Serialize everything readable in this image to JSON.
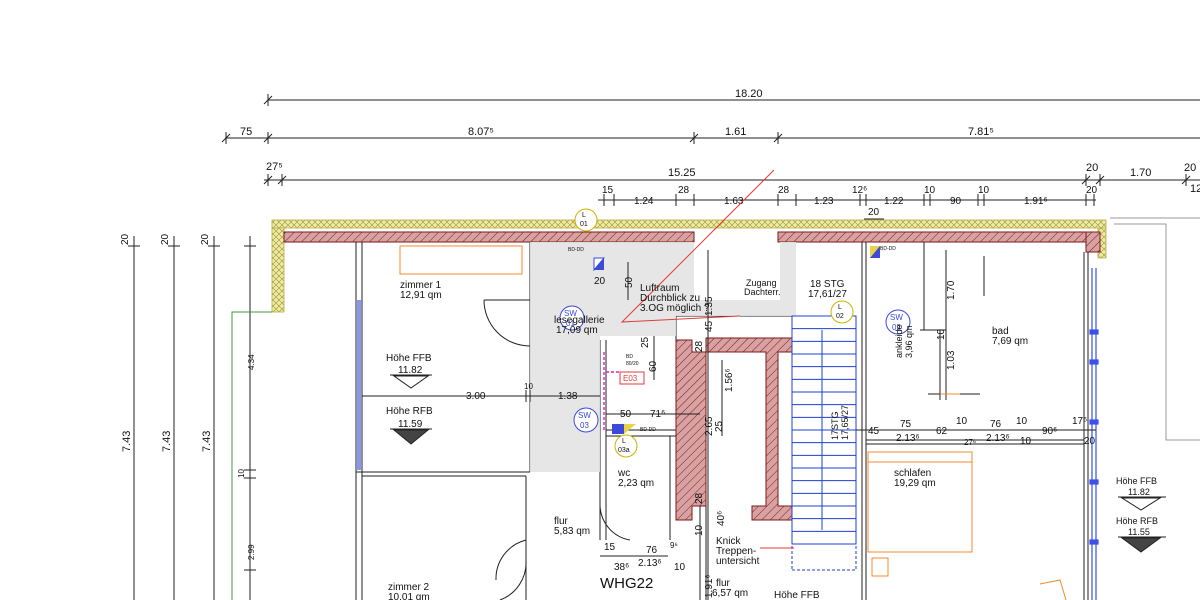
{
  "dimensions": {
    "overall": "18.20",
    "row2": [
      "75",
      "8.07⁵",
      "1.61",
      "7.81⁵"
    ],
    "row3": [
      "27⁵",
      "15.25",
      "20",
      "1.70",
      "20",
      "12"
    ],
    "row4": [
      "15",
      "1.24",
      "28",
      "1.63",
      "28",
      "1.23",
      "12⁶",
      "1.22",
      "10",
      "90",
      "10",
      "1.91⁶",
      "20"
    ],
    "row4b": "20",
    "left_stack": [
      "20",
      "20",
      "20"
    ],
    "left_heights": [
      "7.43",
      "7.43",
      "7.43"
    ],
    "left_segments": [
      "4.34",
      "10",
      "2.99"
    ],
    "horizontal_mid": [
      "3.00",
      "10",
      "1.38",
      "50",
      "71⁶"
    ],
    "right_mid": [
      "45",
      "75",
      "2.13⁶",
      "62",
      "10",
      "27⁶",
      "76",
      "2.13⁶",
      "10",
      "10",
      "90⁶",
      "17⁶",
      "20"
    ],
    "vertical_center": [
      "1.35",
      "45",
      "28",
      "25",
      "60",
      "1.56⁶",
      "2.65",
      "25",
      "28",
      "40⁶",
      "10",
      "1.91⁶"
    ],
    "small_misc": [
      "50",
      "20",
      "1.70",
      "10",
      "1.03"
    ],
    "wc_row": [
      "15",
      "76",
      "9⁶",
      "38⁶",
      "2.13⁶",
      "10"
    ]
  },
  "rooms": [
    {
      "name": "zimmer 1",
      "area": "12,91 qm"
    },
    {
      "name": "lesegallerie",
      "area": "17,09 qm"
    },
    {
      "name": "Luftraum",
      "line2": "Durchblick zu",
      "line3": "3.OG möglich ?"
    },
    {
      "name": "Zugang",
      "line2": "Dachterr."
    },
    {
      "name": "18 STG",
      "area": "17,61/27"
    },
    {
      "name": "ankleide",
      "area": "3,96 qm"
    },
    {
      "name": "bad",
      "area": "7,69 qm"
    },
    {
      "name": "wc",
      "area": "2,23 qm"
    },
    {
      "name": "flur",
      "area": "5,83 qm"
    },
    {
      "name": "schlafen",
      "area": "19,29 qm"
    },
    {
      "name": "zimmer 2",
      "area": "10,01 qm"
    },
    {
      "name": "flur",
      "area": "6,57 qm"
    }
  ],
  "levels": [
    {
      "label": "Höhe FFB",
      "value": "11.82"
    },
    {
      "label": "Höhe RFB",
      "value": "11.59"
    },
    {
      "label": "Höhe FFB",
      "value": "11.82"
    },
    {
      "label": "Höhe RFB",
      "value": "11.55"
    },
    {
      "label": "Höhe FFB"
    }
  ],
  "tags": {
    "sw01": [
      "SW",
      "01"
    ],
    "sw02": [
      "SW",
      "02"
    ],
    "sw03": [
      "SW",
      "03"
    ],
    "l01": [
      "L",
      "01"
    ],
    "l02": [
      "L",
      "02"
    ],
    "l03a": [
      "L",
      "03a"
    ],
    "bd": "BD-DD",
    "bd_small": [
      "BD",
      "80/20"
    ],
    "e03": "E03"
  },
  "annotations": {
    "stairs_small": "17STG",
    "stairs_small_val": "17,65/27",
    "knick": [
      "Knick",
      "Treppen-",
      "untersicht"
    ],
    "unit": "WHG22"
  },
  "colors": {
    "wall_fill": "#d9a2a2",
    "wall_stroke": "#7a1a1a",
    "insulation": "#e8e39a",
    "gallery_fill": "#e3e3e3",
    "stair_blue": "#1f3fd0",
    "tag_blue": "#3b4ad8",
    "tag_yellow": "#c9b500",
    "window_blue": "#3a50e6",
    "red_line": "#e33b3b",
    "orange": "#f08a30",
    "green": "#3f9f3f",
    "magenta": "#e020c8"
  }
}
